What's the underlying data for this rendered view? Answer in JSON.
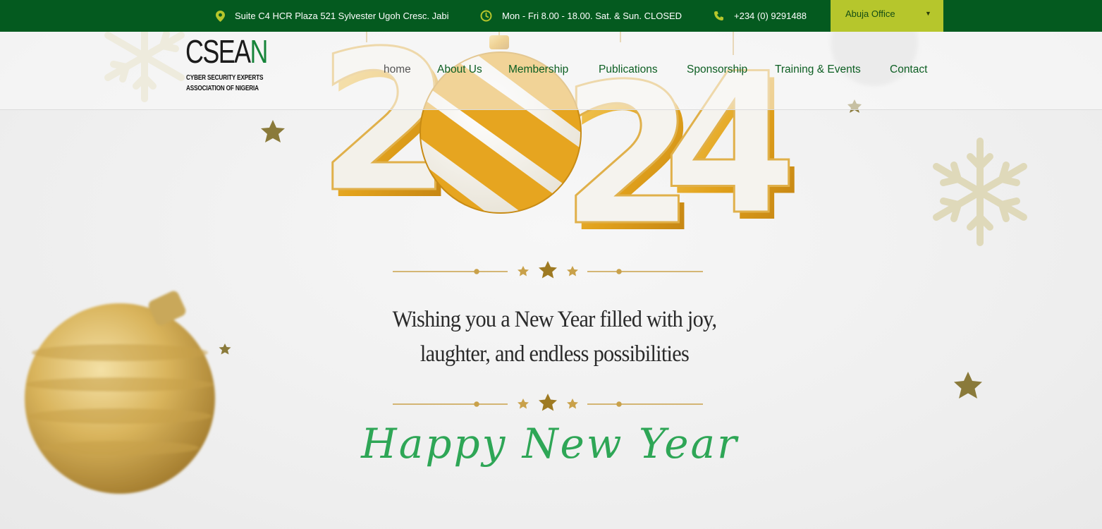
{
  "topbar": {
    "address": "Suite C4 HCR Plaza 521 Sylvester Ugoh Cresc. Jabi",
    "hours": "Mon - Fri 8.00 - 18.00. Sat. & Sun. CLOSED",
    "phone": "+234 (0) 9291488",
    "office_selected": "Abuja Office",
    "icons": [
      "map-pin-icon",
      "clock-icon",
      "phone-icon",
      "caret-down-icon"
    ]
  },
  "logo": {
    "word_main": "CSEA",
    "word_accent": "N",
    "line1": "CYBER SECURITY EXPERTS",
    "line2": "ASSOCIATION OF NIGERIA"
  },
  "nav": {
    "items": [
      "home",
      "About Us",
      "Membership",
      "Publications",
      "Sponsorship",
      "Training & Events",
      "Contact"
    ]
  },
  "hero": {
    "year_digits": [
      "2",
      "2",
      "4"
    ],
    "message_line1": "Wishing you a New Year filled with joy,",
    "message_line2": "laughter, and endless possibilities",
    "script_greeting": "Happy New Year"
  },
  "colors": {
    "topbar_green": "#045a1f",
    "office_lime": "#b6c62c",
    "nav_green": "#0c5e22",
    "gold": "#e2a21c",
    "script_green": "#2ea656"
  }
}
